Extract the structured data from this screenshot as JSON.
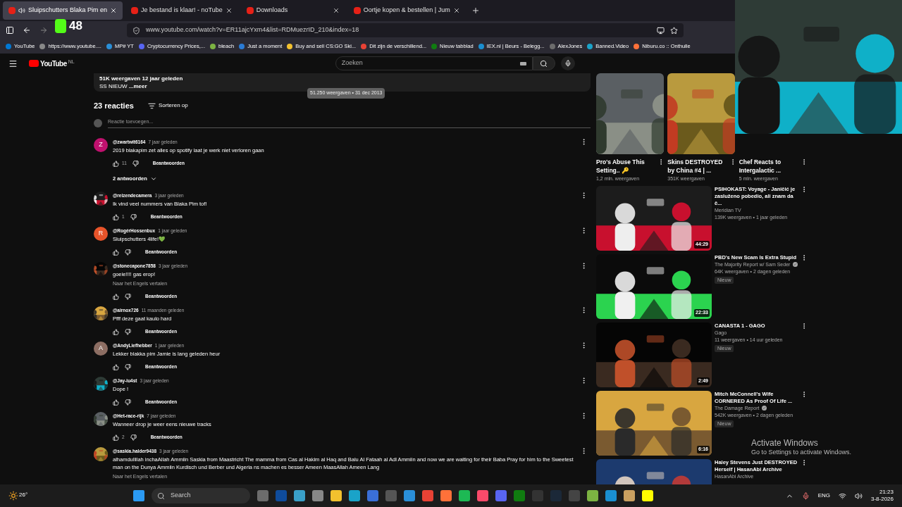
{
  "browser": {
    "tabs": [
      {
        "title": "Sluipschutters Blaka Pim en",
        "selected": true,
        "playing": true
      },
      {
        "title": "Je bestand is klaar! - noTube",
        "selected": false,
        "playing": false
      },
      {
        "title": "Downloads",
        "selected": false,
        "playing": false
      },
      {
        "title": "Oortje kopen & bestellen | Jum",
        "selected": false,
        "playing": false
      }
    ],
    "overlay_counter": "48",
    "address": "www.youtube.com/watch?v=ER11ajcYxm4&list=RDMuezrID_210&index=18",
    "bookmarks": [
      "YouTube",
      "https://www.youtube....",
      "MP# YT",
      "Cryptocurrency Prices,...",
      "bleach",
      "Just a moment",
      "Buy and sell CS:GO Ski...",
      "Dit zijn de verschillend...",
      "Nieuw tabblad",
      "IEX.nl | Beurs - Belegg...",
      "AlexJones",
      "Banned.Video",
      "Niburu.co :: Onthulle"
    ]
  },
  "youtube": {
    "logo": "YouTube",
    "region": "NL",
    "search_placeholder": "Zoeken"
  },
  "description": {
    "stats": "51K weergaven  12 jaar geleden",
    "text": "SS NIEUW ",
    "more": "...meer",
    "tooltip": "51.250 weergaven • 31 dec 2013"
  },
  "comments_header": {
    "count": "23 reacties",
    "sort": "Sorteren op",
    "add_placeholder": "Reactie toevoegen..."
  },
  "comments": [
    {
      "kind": "letter",
      "letter": "Z",
      "color": "#c0116e",
      "handle": "@zwartwit6164",
      "time": "7 jaar geleden",
      "text": "2019 blakapim zet alles op spotify laat je werk niet verloren gaan",
      "likes": "11",
      "reply": "Beantwoorden",
      "replies": "2 antwoorden"
    },
    {
      "kind": "picture",
      "handle": "@reizendecamera",
      "time": "3 jaar geleden",
      "text": "Ik vind veel nummers van Blaka Pim tof!",
      "likes": "1",
      "reply": "Beantwoorden"
    },
    {
      "kind": "letter",
      "letter": "R",
      "color": "#e8542a",
      "handle": "@RogérHossenbux",
      "time": "1 jaar geleden",
      "text": "Sluipschutters 4life!💚",
      "reply": "Beantwoorden"
    },
    {
      "kind": "picture",
      "handle": "@stonecapone7858",
      "time": "3 jaar geleden",
      "text": "goeie!!!! gas erop!",
      "translate": "Naar het Engels vertalen",
      "reply": "Beantwoorden"
    },
    {
      "kind": "picture",
      "handle": "@airnox726",
      "time": "11 maanden geleden",
      "text": "Pfff deze gaat kaulo hard",
      "reply": "Beantwoorden"
    },
    {
      "kind": "letter",
      "letter": "A",
      "color": "#8d6e63",
      "handle": "@AndyLiefhebber",
      "time": "1 jaar geleden",
      "text": "Lekker blakka pim Jamie  is lang geleden heur",
      "reply": "Beantwoorden"
    },
    {
      "kind": "picture",
      "handle": "@Jay-iu4st",
      "time": "3 jaar geleden",
      "text": "Dope !",
      "reply": "Beantwoorden"
    },
    {
      "kind": "picture",
      "handle": "@Het-race-rijk",
      "time": "7 jaar geleden",
      "text": "Wanneer drop je weer eens nieuwe tracks",
      "likes": "2",
      "reply": "Beantwoorden"
    },
    {
      "kind": "picture",
      "handle": "@saskia.halder9438",
      "time": "3 jaar geleden",
      "text": "alhamdullilah inchaAllah Ammiin Saskia from Maastricht The mamma from Cas al Hakim al Haq and Balu Al Fataah al Adl Ammiin and now we are waiting for their Baba Pray for him to the Sweetest man on the Dunya Ammiin Kurdisch und Berber und Algeria ns machen es besser Ameen MaasAllah Ameen Lang",
      "translate": "Naar het Engels vertalen"
    }
  ],
  "shorts": [
    {
      "title": "Pro's Abuse This Setting.. 🔑",
      "views": "1,2 mln. weergaven"
    },
    {
      "title": "Skins DESTROYED by China #4 | ...",
      "views": "351K weergaven"
    },
    {
      "title": "Chef Reacts to Intergalactic ...",
      "views": "5 mln. weergaven"
    }
  ],
  "videos": [
    {
      "title": "PSIHOKAST: Voyage - Janičić je zasluženo pobedio, ali znam da č...",
      "channel": "Meridian TV",
      "verified": false,
      "meta": "139K weergaven • 1 jaar geleden",
      "duration": "44:29"
    },
    {
      "title": "PBD's New Scam Is Extra Stupid",
      "channel": "The Majority Report w/ Sam Seder",
      "verified": true,
      "meta": "64K weergaven • 2 dagen geleden",
      "badge": "Nieuw",
      "duration": "22:33"
    },
    {
      "title": "CANASTA 1 - GAGO",
      "channel": "Gago",
      "verified": false,
      "meta": "11 weergaven • 14 uur geleden",
      "badge": "Nieuw",
      "duration": "2:49"
    },
    {
      "title": "Mitch McConnell's Wife CORNERED As Proof Of Life ...",
      "channel": "The Damage Report",
      "verified": true,
      "meta": "542K weergaven • 2 dagen geleden",
      "badge": "Nieuw",
      "duration": "6:16"
    },
    {
      "title": "Haley Stevens Just DESTROYED Herself | HasanAbi Archive",
      "channel": "HasanAbi Archive",
      "verified": false
    }
  ],
  "activation": {
    "title": "Activate Windows",
    "text": "Go to Settings to activate Windows."
  },
  "taskbar": {
    "weather": "26°",
    "search": "Search",
    "language": "ENG",
    "time": "21:23",
    "date": "3-8-2026"
  }
}
